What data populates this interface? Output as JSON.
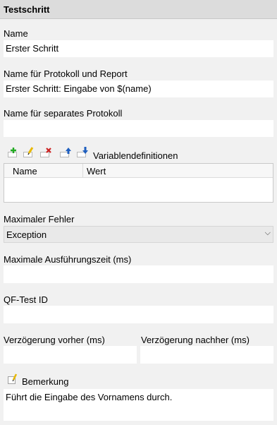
{
  "panel": {
    "title": "Testschritt"
  },
  "name": {
    "label": "Name",
    "value": "Erster Schritt"
  },
  "report_name": {
    "label": "Name für Protokoll und Report",
    "value": "Erster Schritt: Eingabe von $(name)"
  },
  "separate_log": {
    "label": "Name für separates Protokoll",
    "value": ""
  },
  "variables": {
    "label": "Variablendefinitionen",
    "columns": [
      "Name",
      "Wert"
    ],
    "toolbar_icons": [
      "add-icon",
      "edit-icon",
      "delete-icon",
      "move-up-icon",
      "move-down-icon"
    ]
  },
  "max_error": {
    "label": "Maximaler Fehler",
    "selected": "Exception"
  },
  "max_runtime": {
    "label": "Maximale Ausführungszeit (ms)",
    "value": ""
  },
  "qftest_id": {
    "label": "QF-Test ID",
    "value": ""
  },
  "delay_before": {
    "label": "Verzögerung vorher (ms)",
    "value": ""
  },
  "delay_after": {
    "label": "Verzögerung nachher (ms)",
    "value": ""
  },
  "comment": {
    "label": "Bemerkung",
    "value": "Führt die Eingabe des Vornamens durch."
  },
  "colors": {
    "header_bg": "#dcdcdc",
    "panel_bg": "#f1f1f1",
    "add": "#22aa22",
    "delete": "#cc2222",
    "arrow": "#1f5fbf",
    "pencil": "#e8b800"
  }
}
